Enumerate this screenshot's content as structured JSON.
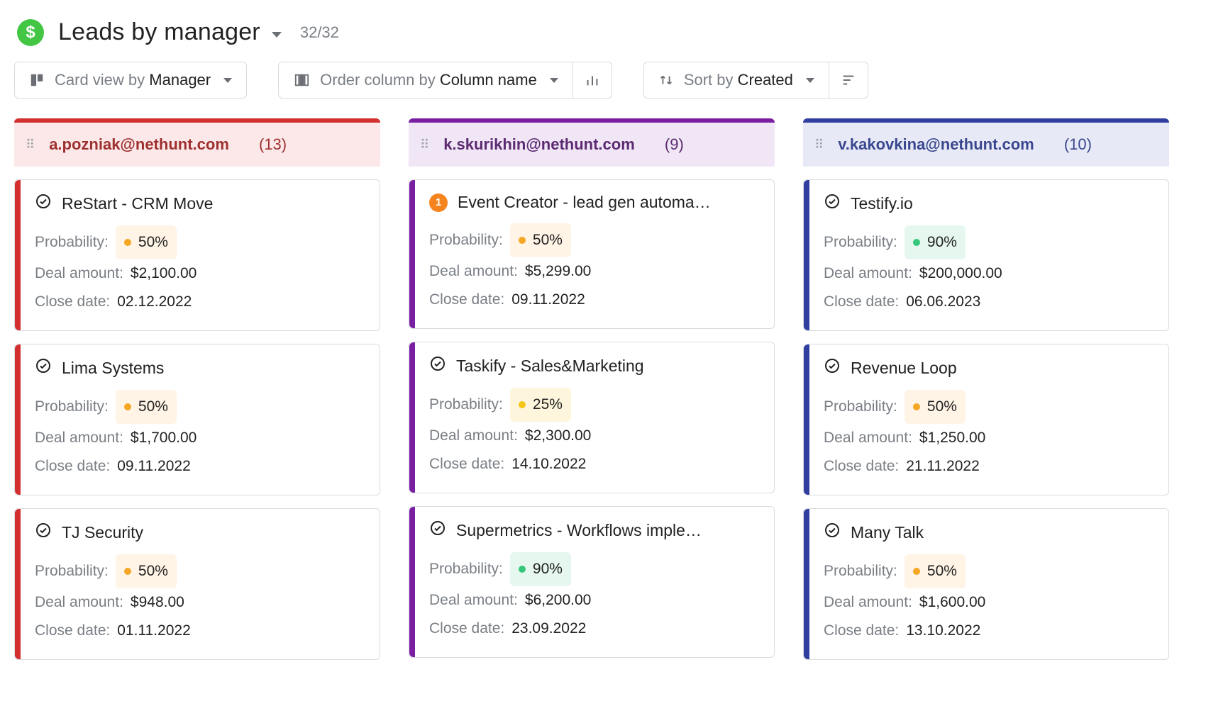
{
  "header": {
    "title": "Leads by manager",
    "count": "32/32"
  },
  "toolbar": {
    "card_view": {
      "prefix": "Card view by ",
      "value": "Manager"
    },
    "order": {
      "prefix": "Order column by ",
      "value": "Column name"
    },
    "sort": {
      "prefix": "Sort by ",
      "value": "Created"
    }
  },
  "labels": {
    "probability": "Probability:",
    "deal_amount": "Deal amount:",
    "close_date": "Close date:"
  },
  "columns": [
    {
      "color": "red",
      "manager": "a.pozniak@nethunt.com",
      "count": "(13)",
      "cards": [
        {
          "icon": "check",
          "title": "ReStart - CRM Move",
          "probability": "50%",
          "prob_color": "orange",
          "deal_amount": "$2,100.00",
          "close_date": "02.12.2022"
        },
        {
          "icon": "check",
          "title": "Lima Systems",
          "probability": "50%",
          "prob_color": "orange",
          "deal_amount": "$1,700.00",
          "close_date": "09.11.2022"
        },
        {
          "icon": "check",
          "title": "TJ Security",
          "probability": "50%",
          "prob_color": "orange",
          "deal_amount": "$948.00",
          "close_date": "01.11.2022"
        }
      ]
    },
    {
      "color": "purple",
      "manager": "k.skurikhin@nethunt.com",
      "count": "(9)",
      "cards": [
        {
          "icon": "badge",
          "badge": "1",
          "title": "Event Creator - lead gen automa…",
          "probability": "50%",
          "prob_color": "orange",
          "deal_amount": "$5,299.00",
          "close_date": "09.11.2022"
        },
        {
          "icon": "check",
          "title": "Taskify - Sales&Marketing",
          "probability": "25%",
          "prob_color": "yellow",
          "deal_amount": "$2,300.00",
          "close_date": "14.10.2022"
        },
        {
          "icon": "check",
          "title": "Supermetrics - Workflows imple…",
          "probability": "90%",
          "prob_color": "green",
          "deal_amount": "$6,200.00",
          "close_date": "23.09.2022"
        }
      ]
    },
    {
      "color": "blue",
      "manager": "v.kakovkina@nethunt.com",
      "count": "(10)",
      "cards": [
        {
          "icon": "check",
          "title": "Testify.io",
          "probability": "90%",
          "prob_color": "green",
          "deal_amount": "$200,000.00",
          "close_date": "06.06.2023"
        },
        {
          "icon": "check",
          "title": "Revenue Loop",
          "probability": "50%",
          "prob_color": "orange",
          "deal_amount": "$1,250.00",
          "close_date": "21.11.2022"
        },
        {
          "icon": "check",
          "title": "Many Talk",
          "probability": "50%",
          "prob_color": "orange",
          "deal_amount": "$1,600.00",
          "close_date": "13.10.2022"
        }
      ]
    }
  ]
}
